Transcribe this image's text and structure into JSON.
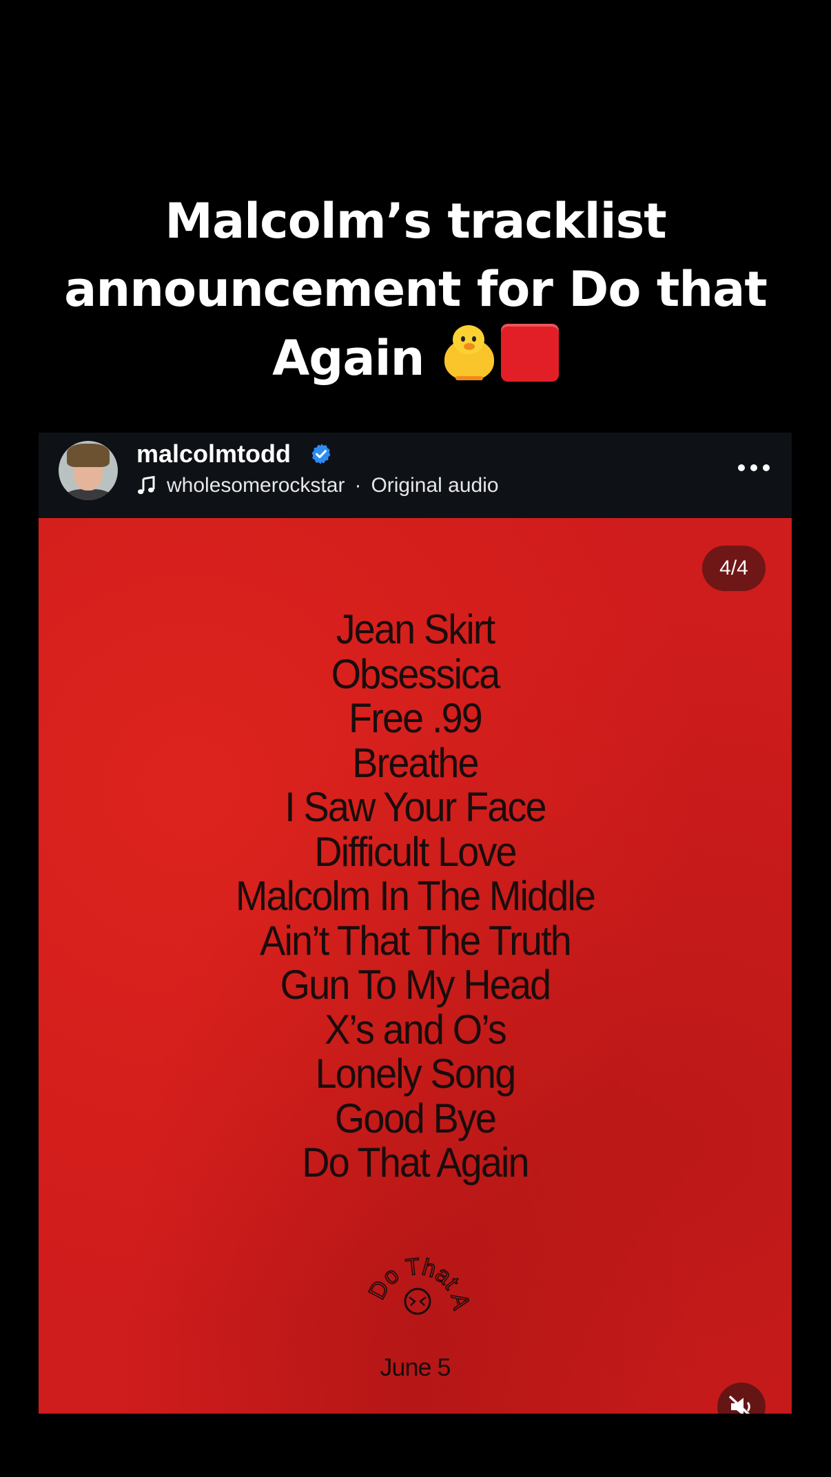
{
  "caption": {
    "text": "Malcolm’s tracklist announcement for Do that Again",
    "emoji_1": "chick-emoji",
    "emoji_2": "red-square-emoji"
  },
  "post": {
    "username": "malcolmtodd",
    "verified": true,
    "audio_artist": "wholesomerockstar",
    "audio_separator": "·",
    "audio_title": "Original audio",
    "more_icon": "more-horizontal-icon",
    "slide_counter": "4/4",
    "tracks": [
      "Jean Skirt",
      "Obsessica",
      "Free .99",
      "Breathe",
      "I Saw Your Face",
      "Difficult Love",
      "Malcolm In The Middle",
      "Ain’t That The Truth",
      "Gun To My Head",
      "X’s and O’s",
      "Lonely Song",
      "Good Bye",
      "Do That Again"
    ],
    "logo_text": "Do That Again",
    "release_date": "June 5",
    "mute_icon": "speaker-muted-icon",
    "background_color": "#cf1c1c",
    "verified_color": "#2d8cf0"
  }
}
